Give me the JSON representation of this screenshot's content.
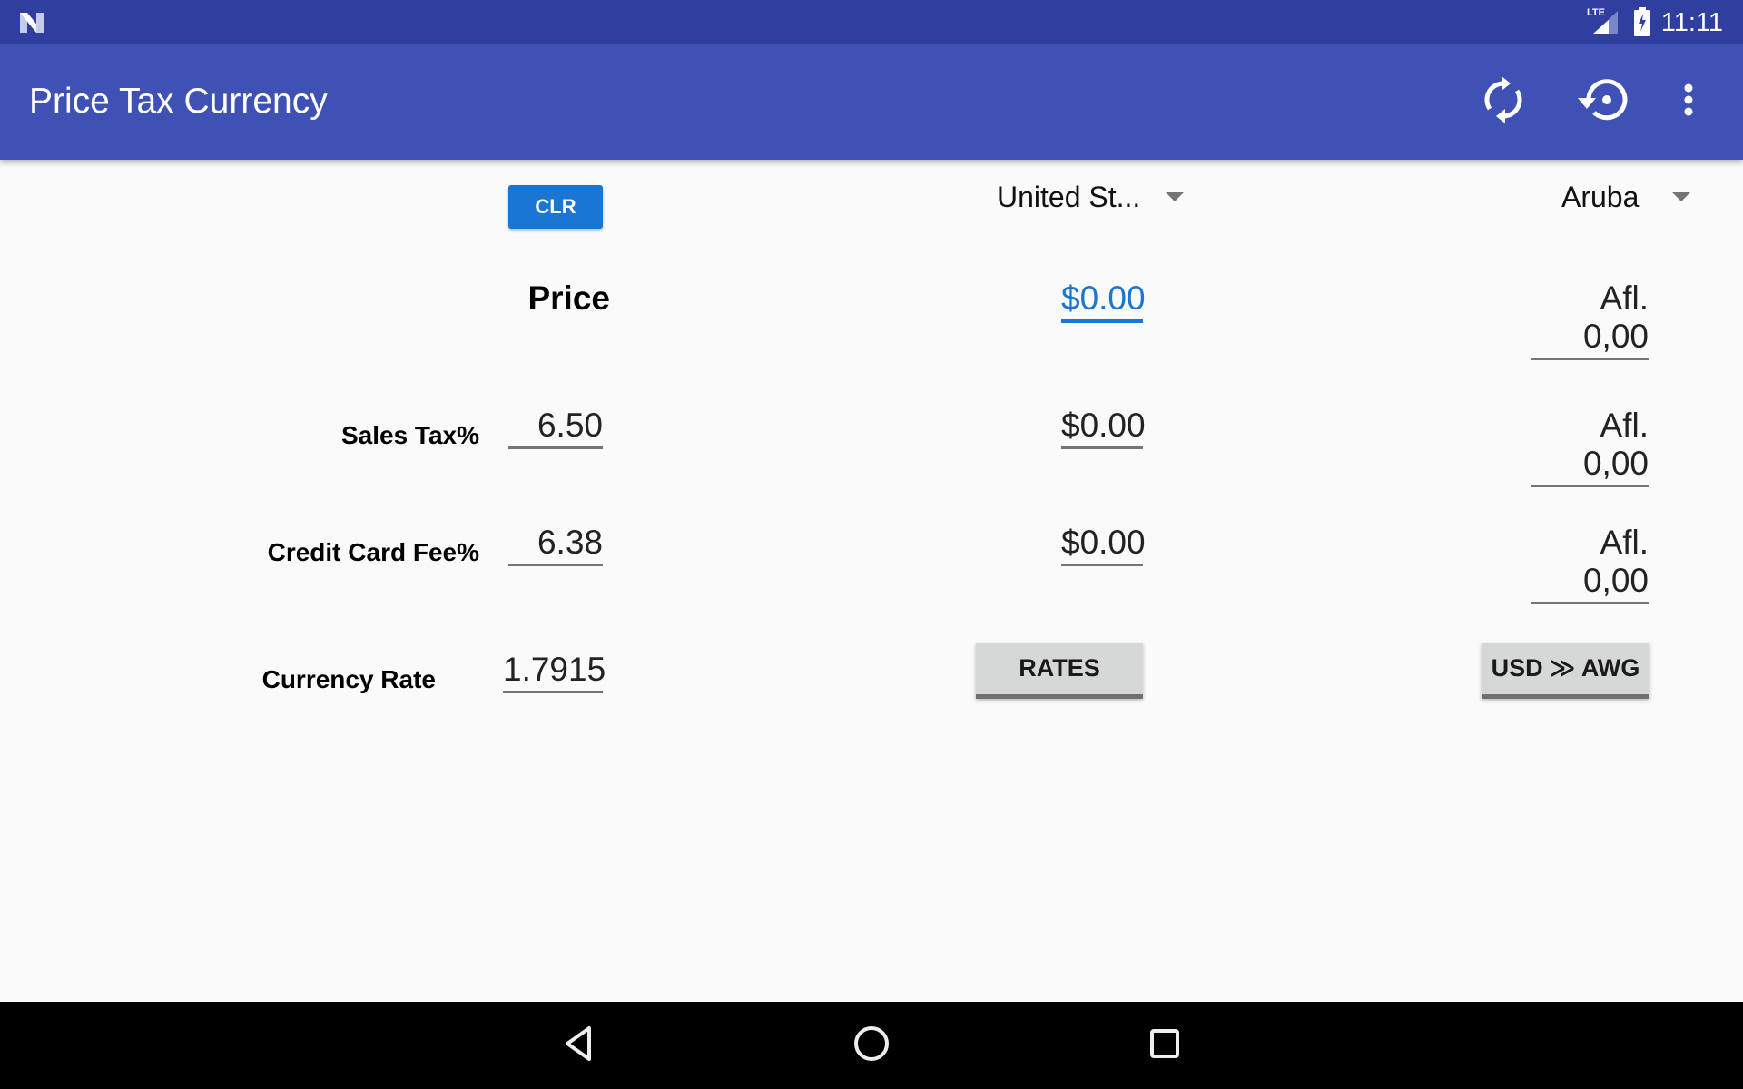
{
  "status_bar": {
    "network_label": "LTE",
    "time": "11:11"
  },
  "app_bar": {
    "title": "Price Tax Currency",
    "actions": [
      {
        "name": "refresh",
        "icon": "sync-icon"
      },
      {
        "name": "restore",
        "icon": "restore-icon"
      },
      {
        "name": "more",
        "icon": "more-vert-icon"
      }
    ]
  },
  "top_controls": {
    "clear_label": "CLR",
    "from_currency": "United St...",
    "to_currency": "Aruba"
  },
  "rows": {
    "price": {
      "label": "Price",
      "from_value": "$0.00",
      "to_value": "Afl. 0,00"
    },
    "sales_tax": {
      "label": "Sales Tax%",
      "input": "6.50",
      "from_value": "$0.00",
      "to_value": "Afl. 0,00"
    },
    "credit_card_fee": {
      "label": "Credit Card Fee%",
      "input": "6.38",
      "from_value": "$0.00",
      "to_value": "Afl. 0,00"
    },
    "currency_rate": {
      "label": "Currency Rate",
      "input": "1.7915",
      "rates_button": "RATES",
      "direction_button": "USD ≫ AWG"
    }
  },
  "colors": {
    "status_bar": "#303f9f",
    "app_bar": "#3f51b5",
    "accent": "#1976d2",
    "background": "#fafafa"
  }
}
